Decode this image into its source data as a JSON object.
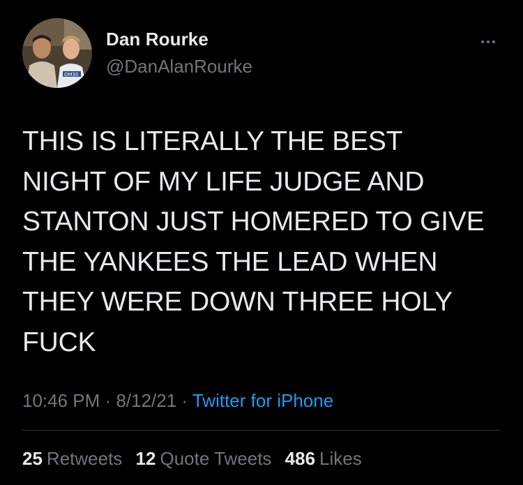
{
  "author": {
    "display_name": "Dan Rourke",
    "handle": "@DanAlanRourke",
    "avatar_icon": "profile-photo"
  },
  "tweet": {
    "text": "THIS IS LITERALLY THE BEST\nNIGHT OF MY LIFE JUDGE AND\nSTANTON JUST HOMERED TO GIVE\nTHE YANKEES THE LEAD WHEN\nTHEY WERE DOWN THREE HOLY\nFUCK",
    "time": "10:46 PM",
    "separator": "·",
    "date": "8/12/21",
    "source": "Twitter for iPhone"
  },
  "stats": {
    "retweets_count": "25",
    "retweets_label": "Retweets",
    "quotes_count": "12",
    "quotes_label": "Quote Tweets",
    "likes_count": "486",
    "likes_label": "Likes"
  },
  "colors": {
    "background": "#000000",
    "primary_text": "#e7e9ea",
    "secondary_text": "#71767b",
    "link": "#1d9bf0",
    "divider": "#2f3336"
  },
  "icons": {
    "more": "more-horizontal-icon"
  }
}
